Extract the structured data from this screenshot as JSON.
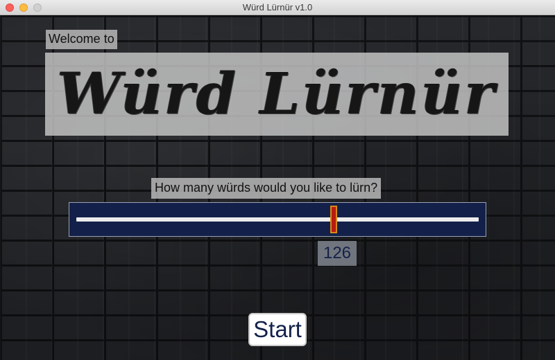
{
  "window": {
    "title": "Würd Lürnür v1.0"
  },
  "welcome_label": "Welcome to",
  "app_title": "Würd Lürnür",
  "question_label": "How many würds would you like to lürn?",
  "slider": {
    "value": 126,
    "value_text": "126",
    "position_fraction": 0.64
  },
  "start_button_label": "Start",
  "colors": {
    "slider_background": "#13214a",
    "slider_thumb": "#b71c10",
    "slider_track": "#ececec",
    "button_text": "#13214a"
  },
  "icons": {
    "close": "close-icon",
    "minimize": "minimize-icon",
    "maximize": "maximize-icon"
  }
}
